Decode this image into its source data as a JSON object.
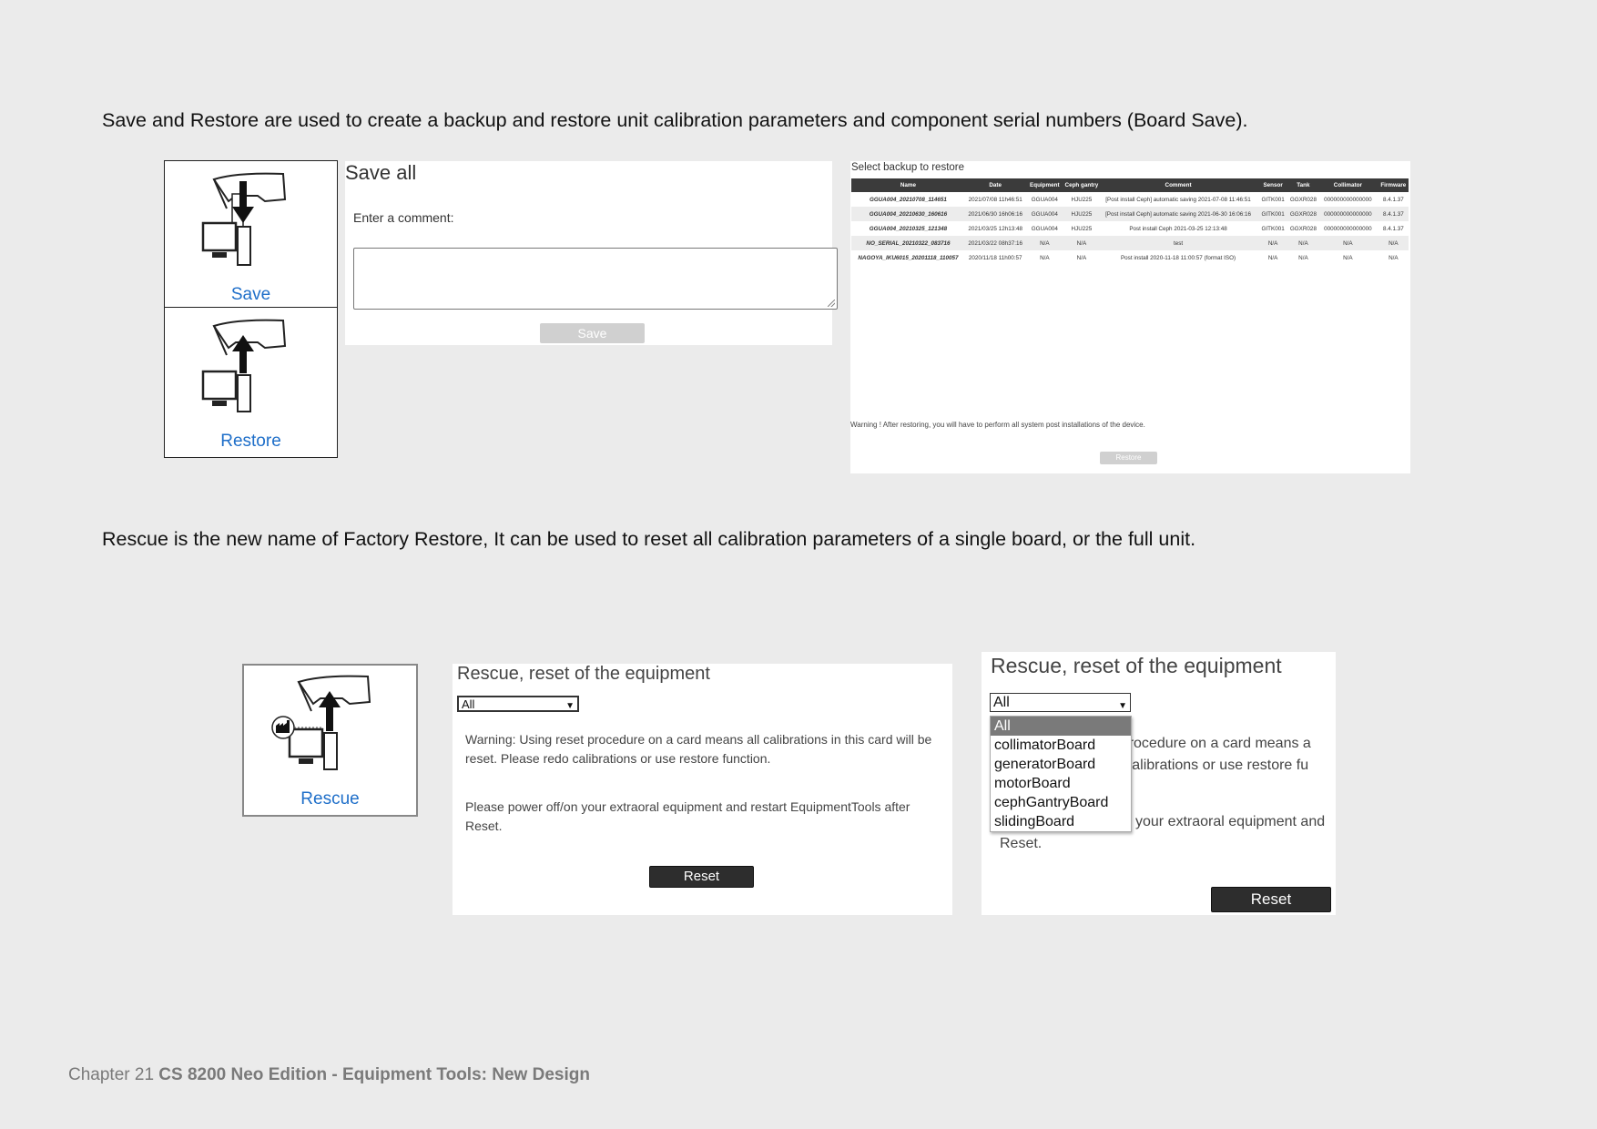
{
  "intro_text": "Save and Restore are used to create a backup and restore unit calibration parameters and component serial numbers (Board Save).",
  "rescue_text": "Rescue is the new name of Factory Restore, It can be used to reset all calibration parameters of a single board, or the full unit.",
  "icons": {
    "save_label": "Save",
    "restore_label": "Restore",
    "rescue_label": "Rescue"
  },
  "save_panel": {
    "title": "Save all",
    "comment_label": "Enter a comment:",
    "comment_value": "",
    "save_button": "Save"
  },
  "restore_panel": {
    "title": "Select backup to restore",
    "columns": [
      "Name",
      "Date",
      "Equipment",
      "Ceph gantry",
      "Comment",
      "Sensor",
      "Tank",
      "Collimator",
      "Firmware"
    ],
    "rows": [
      [
        "GGUA004_20210708_114651",
        "2021/07/08 11h46:51",
        "GGUA004",
        "HJU225",
        "[Post install Ceph] automatic saving 2021-07-08 11:46:51",
        "GITK001",
        "GGXR028",
        "000000000000000",
        "8.4.1.37"
      ],
      [
        "GGUA004_20210630_160616",
        "2021/06/30 16h06:16",
        "GGUA004",
        "HJU225",
        "[Post install Ceph] automatic saving 2021-06-30 16:06:16",
        "GITK001",
        "GGXR028",
        "000000000000000",
        "8.4.1.37"
      ],
      [
        "GGUA004_20210325_121348",
        "2021/03/25 12h13:48",
        "GGUA004",
        "HJU225",
        "Post install Ceph 2021-03-25 12:13:48",
        "GITK001",
        "GGXR028",
        "000000000000000",
        "8.4.1.37"
      ],
      [
        "NO_SERIAL_20210322_083716",
        "2021/03/22 08h37:16",
        "N/A",
        "N/A",
        "test",
        "N/A",
        "N/A",
        "N/A",
        "N/A"
      ],
      [
        "NAGOYA_IKU6015_20201118_110057",
        "2020/11/18 11h00:57",
        "N/A",
        "N/A",
        "Post install 2020-11-18 11:00:57 (format ISO)",
        "N/A",
        "N/A",
        "N/A",
        "N/A"
      ]
    ],
    "warning": "Warning ! After restoring, you will have to perform all system post installations of the device.",
    "restore_button": "Restore"
  },
  "rescue_panel": {
    "title": "Rescue, reset of the equipment",
    "select_value": "All",
    "warning": "Warning: Using reset procedure on a card means all calibrations in this card will be reset. Please redo calibrations or use restore function.",
    "power_text": "Please power off/on your extraoral equipment and restart EquipmentTools after Reset.",
    "reset_button": "Reset"
  },
  "rescue_panel_open": {
    "title": "Rescue, reset of the equipment",
    "select_value": "All",
    "options": [
      "All",
      "collimatorBoard",
      "generatorBoard",
      "motorBoard",
      "cephGantryBoard",
      "slidingBoard"
    ],
    "warning_line1": "et procedure on a card means a",
    "warning_line2": "do calibrations or use restore fu",
    "power_line1": "your extraoral equipment and",
    "power_line2": "Reset.",
    "reset_button": "Reset"
  },
  "footer": {
    "chapter": "Chapter 21",
    "title": "CS 8200 Neo Edition - Equipment Tools: New Design"
  }
}
